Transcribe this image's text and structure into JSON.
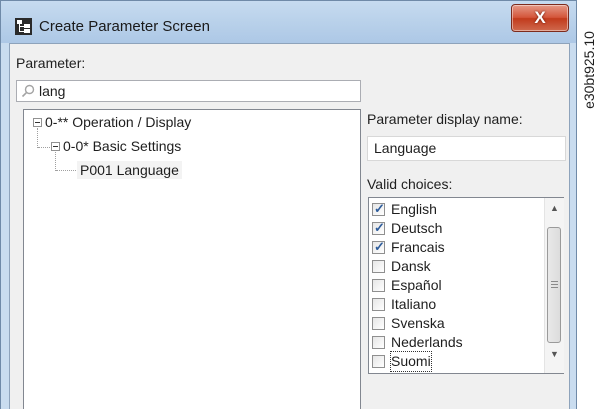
{
  "window": {
    "title": "Create Parameter Screen",
    "close_label": "X"
  },
  "parameter_label": "Parameter:",
  "search": {
    "value": "lang",
    "icon": "search-icon"
  },
  "tree": {
    "root": "0-** Operation / Display",
    "group": "0-0* Basic Settings",
    "leaf": "P001 Language"
  },
  "display_name": {
    "label": "Parameter display name:",
    "value": "Language"
  },
  "valid_choices": {
    "label": "Valid choices:",
    "items": [
      {
        "label": "English",
        "checked": true
      },
      {
        "label": "Deutsch",
        "checked": true
      },
      {
        "label": "Francais",
        "checked": true
      },
      {
        "label": "Dansk",
        "checked": false
      },
      {
        "label": "Español",
        "checked": false
      },
      {
        "label": "Italiano",
        "checked": false
      },
      {
        "label": "Svenska",
        "checked": false
      },
      {
        "label": "Nederlands",
        "checked": false
      },
      {
        "label": "Suomi",
        "checked": false
      }
    ]
  },
  "side_code": "e30bt925.10",
  "colors": {
    "title_bar": "#b9d1ea",
    "close_button": "#c23a1c",
    "check": "#2f5d9b"
  }
}
